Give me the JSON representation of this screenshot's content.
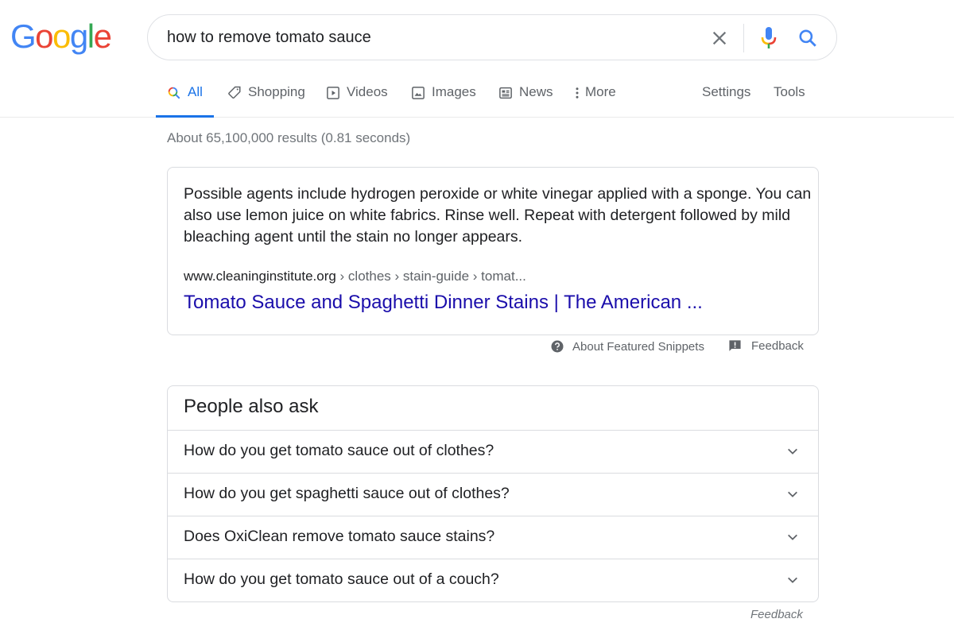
{
  "logo": {
    "letters": [
      {
        "char": "G",
        "color": "#4285F4"
      },
      {
        "char": "o",
        "color": "#EA4335"
      },
      {
        "char": "o",
        "color": "#FBBC05"
      },
      {
        "char": "g",
        "color": "#4285F4"
      },
      {
        "char": "l",
        "color": "#34A853"
      },
      {
        "char": "e",
        "color": "#EA4335"
      }
    ]
  },
  "search": {
    "query": "how to remove tomato sauce",
    "clear_icon": "close-icon",
    "mic_icon": "microphone-icon",
    "search_icon": "search-icon"
  },
  "tabs": [
    {
      "label": "All",
      "icon": "search-icon",
      "active": true
    },
    {
      "label": "Shopping",
      "icon": "tag-icon",
      "active": false
    },
    {
      "label": "Videos",
      "icon": "play-icon",
      "active": false
    },
    {
      "label": "Images",
      "icon": "image-icon",
      "active": false
    },
    {
      "label": "News",
      "icon": "news-icon",
      "active": false
    },
    {
      "label": "More",
      "icon": "more-vert-icon",
      "active": false
    }
  ],
  "tools": {
    "settings": "Settings",
    "tools": "Tools"
  },
  "stats": "About 65,100,000 results (0.81 seconds)",
  "featured_snippet": {
    "text": "Possible agents include hydrogen peroxide or white vinegar applied with a sponge. You can also use lemon juice on white fabrics. Rinse well. Repeat with detergent followed by mild bleaching agent until the stain no longer appears.",
    "cite_domain": "www.cleaninginstitute.org",
    "cite_crumbs": " › clothes › stain-guide › tomat...",
    "title": "Tomato Sauce and Spaghetti Dinner Stains | The American ...",
    "about_label": "About Featured Snippets",
    "feedback_label": "Feedback"
  },
  "people_also_ask": {
    "title": "People also ask",
    "questions": [
      "How do you get tomato sauce out of clothes?",
      "How do you get spaghetti sauce out of clothes?",
      "Does OxiClean remove tomato sauce stains?",
      "How do you get tomato sauce out of a couch?"
    ],
    "feedback_label": "Feedback"
  },
  "colors": {
    "accent": "#1a73e8",
    "link": "#1a0dab",
    "text": "#202124",
    "muted": "#5f6368"
  }
}
